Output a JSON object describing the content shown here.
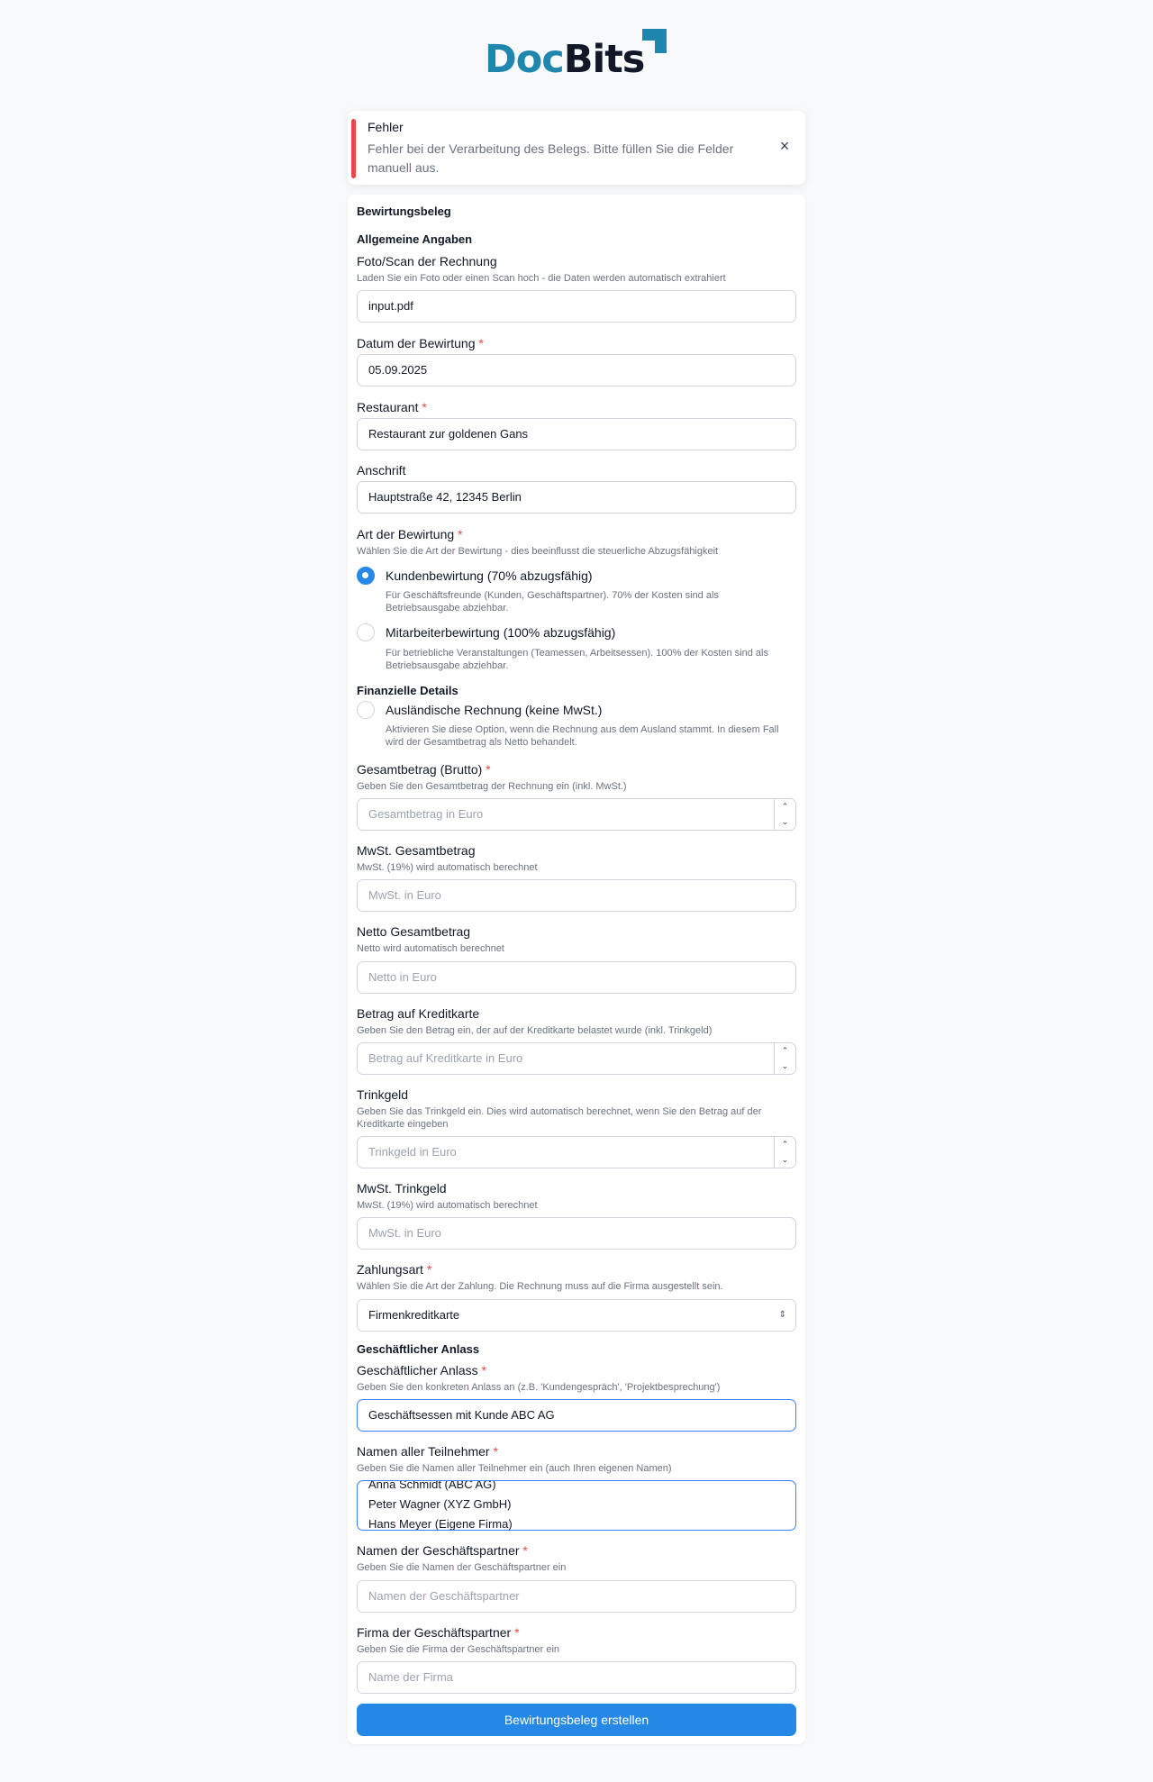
{
  "logo": {
    "doc": "Doc",
    "bits": "Bits",
    "colors": {
      "doc": "#1f86ad",
      "bits": "#111827",
      "mark": "#1f86ad"
    }
  },
  "alert": {
    "title": "Fehler",
    "message": "Fehler bei der Verarbeitung des Belegs. Bitte füllen Sie die Felder manuell aus.",
    "close_icon": "close-icon",
    "accent": "#ef4444"
  },
  "form": {
    "title": "Bewirtungsbeleg",
    "sections": {
      "general": "Allgemeine Angaben",
      "financial": "Finanzielle Details",
      "occasion": "Geschäftlicher Anlass"
    },
    "upload": {
      "label": "Foto/Scan der Rechnung",
      "hint": "Laden Sie ein Foto oder einen Scan hoch - die Daten werden automatisch extrahiert",
      "value": "input.pdf"
    },
    "date": {
      "label": "Datum der Bewirtung",
      "required": "*",
      "value": "05.09.2025"
    },
    "restaurant": {
      "label": "Restaurant",
      "required": "*",
      "value": "Restaurant zur goldenen Gans"
    },
    "address": {
      "label": "Anschrift",
      "value": "Hauptstraße 42, 12345 Berlin"
    },
    "type": {
      "label": "Art der Bewirtung",
      "required": "*",
      "hint": "Wählen Sie die Art der Bewirtung - dies beeinflusst die steuerliche Abzugsfähigkeit",
      "options": [
        {
          "label": "Kundenbewirtung (70% abzugsfähig)",
          "desc": "Für Geschäftsfreunde (Kunden, Geschäftspartner). 70% der Kosten sind als Betriebsausgabe abziehbar.",
          "selected": true
        },
        {
          "label": "Mitarbeiterbewirtung (100% abzugsfähig)",
          "desc": "Für betriebliche Veranstaltungen (Teamessen, Arbeitsessen). 100% der Kosten sind als Betriebsausgabe abziehbar.",
          "selected": false
        }
      ]
    },
    "foreign": {
      "label": "Ausländische Rechnung (keine MwSt.)",
      "desc": "Aktivieren Sie diese Option, wenn die Rechnung aus dem Ausland stammt. In diesem Fall wird der Gesamtbetrag als Netto behandelt.",
      "checked": false
    },
    "gross": {
      "label": "Gesamtbetrag (Brutto)",
      "required": "*",
      "hint": "Geben Sie den Gesamtbetrag der Rechnung ein (inkl. MwSt.)",
      "placeholder": "Gesamtbetrag in Euro"
    },
    "vat_total": {
      "label": "MwSt. Gesamtbetrag",
      "hint": "MwSt. (19%) wird automatisch berechnet",
      "placeholder": "MwSt. in Euro"
    },
    "net_total": {
      "label": "Netto Gesamtbetrag",
      "hint": "Netto wird automatisch berechnet",
      "placeholder": "Netto in Euro"
    },
    "card_amount": {
      "label": "Betrag auf Kreditkarte",
      "hint": "Geben Sie den Betrag ein, der auf der Kreditkarte belastet wurde (inkl. Trinkgeld)",
      "placeholder": "Betrag auf Kreditkarte in Euro"
    },
    "tip": {
      "label": "Trinkgeld",
      "hint": "Geben Sie das Trinkgeld ein. Dies wird automatisch berechnet, wenn Sie den Betrag auf der Kreditkarte eingeben",
      "placeholder": "Trinkgeld in Euro"
    },
    "tip_vat": {
      "label": "MwSt. Trinkgeld",
      "hint": "MwSt. (19%) wird automatisch berechnet",
      "placeholder": "MwSt. in Euro"
    },
    "payment": {
      "label": "Zahlungsart",
      "required": "*",
      "hint": "Wählen Sie die Art der Zahlung. Die Rechnung muss auf die Firma ausgestellt sein.",
      "value": "Firmenkreditkarte"
    },
    "occasion": {
      "label": "Geschäftlicher Anlass",
      "required": "*",
      "hint": "Geben Sie den konkreten Anlass an (z.B. 'Kundengespräch', 'Projektbesprechung')",
      "value": "Geschäftsessen mit Kunde ABC AG"
    },
    "participants": {
      "label": "Namen aller Teilnehmer",
      "required": "*",
      "hint": "Geben Sie die Namen aller Teilnehmer ein (auch Ihren eigenen Namen)",
      "lines": [
        "Anna Schmidt (ABC AG)",
        "Peter Wagner (XYZ GmbH)",
        "Hans Meyer (Eigene Firma)"
      ]
    },
    "partner_names": {
      "label": "Namen der Geschäftspartner",
      "required": "*",
      "hint": "Geben Sie die Namen der Geschäftspartner ein",
      "placeholder": "Namen der Geschäftspartner"
    },
    "partner_company": {
      "label": "Firma der Geschäftspartner",
      "required": "*",
      "hint": "Geben Sie die Firma der Geschäftspartner ein",
      "placeholder": "Name der Firma"
    },
    "submit": "Bewirtungsbeleg erstellen",
    "accent": "#2588e6"
  }
}
